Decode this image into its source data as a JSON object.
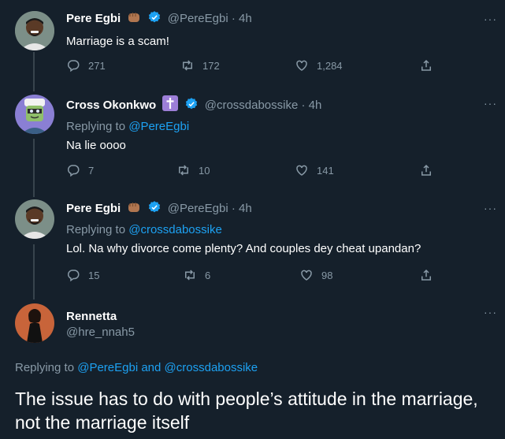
{
  "tweets": [
    {
      "name": "Pere Egbi",
      "handle": "@PereEgbi",
      "time": "· 4h",
      "text": "Marriage is a scam!",
      "replies": "271",
      "retweets": "172",
      "likes": "1,284"
    },
    {
      "name": "Cross Okonkwo",
      "handle": "@crossdabossike",
      "time": "· 4h",
      "replying_label": "Replying to",
      "replying_to": "@PereEgbi",
      "text": "Na lie oooo",
      "replies": "7",
      "retweets": "10",
      "likes": "141"
    },
    {
      "name": "Pere Egbi",
      "handle": "@PereEgbi",
      "time": "· 4h",
      "replying_label": "Replying to",
      "replying_to": "@crossdabossike",
      "text": "Lol. Na why divorce come plenty? And couples dey cheat upandan?",
      "replies": "15",
      "retweets": "6",
      "likes": "98"
    }
  ],
  "focused": {
    "name": "Rennetta",
    "handle": "@hre_nnah5",
    "replying_label": "Replying to",
    "replying_to_1": "@PereEgbi",
    "and_label": "and",
    "replying_to_2": "@crossdabossike",
    "text": "The issue has to do with people’s attitude in the marriage, not the marriage itself"
  },
  "more_label": "···",
  "colors": {
    "background": "#15202b",
    "muted": "#8899a6",
    "link": "#1da1f2",
    "thread_line": "#38444d"
  },
  "icons": [
    "reply-icon",
    "retweet-icon",
    "like-icon",
    "share-icon",
    "verified-icon",
    "fist-emoji-icon",
    "cross-emoji-icon",
    "more-icon"
  ]
}
